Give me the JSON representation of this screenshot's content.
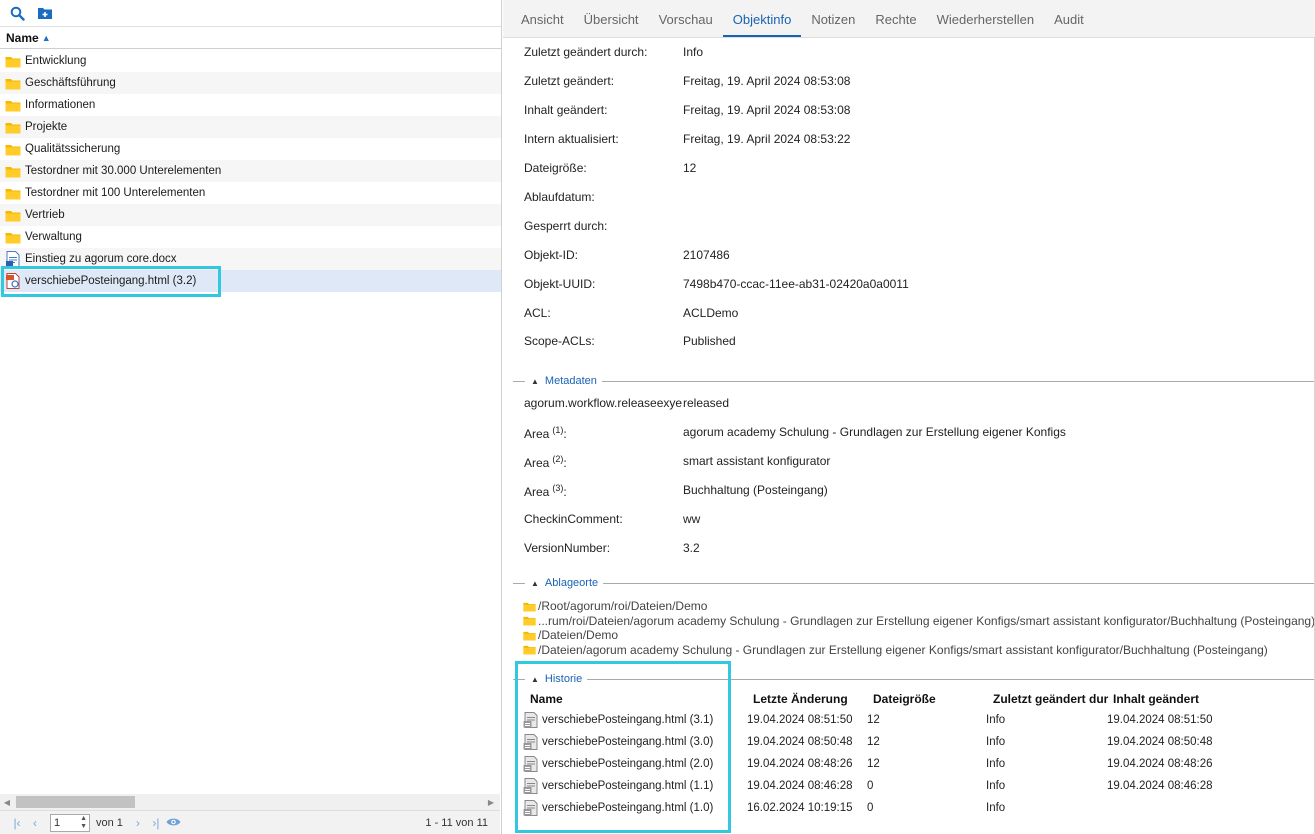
{
  "left": {
    "column_header": "Name",
    "items": [
      {
        "label": "Entwicklung",
        "type": "folder"
      },
      {
        "label": "Geschäftsführung",
        "type": "folder"
      },
      {
        "label": "Informationen",
        "type": "folder"
      },
      {
        "label": "Projekte",
        "type": "folder"
      },
      {
        "label": "Qualitätssicherung",
        "type": "folder"
      },
      {
        "label": "Testordner mit 30.000 Unterelementen",
        "type": "folder"
      },
      {
        "label": "Testordner mit 100 Unterelementen",
        "type": "folder"
      },
      {
        "label": "Vertrieb",
        "type": "folder"
      },
      {
        "label": "Verwaltung",
        "type": "folder"
      },
      {
        "label": "Einstieg zu agorum core.docx",
        "type": "docx"
      },
      {
        "label": "verschiebePosteingang.html (3.2)",
        "type": "html"
      }
    ],
    "pager": {
      "page": "1",
      "of_label": "von 1",
      "count": "1 - 11 von 11"
    }
  },
  "tabs": [
    "Ansicht",
    "Übersicht",
    "Vorschau",
    "Objektinfo",
    "Notizen",
    "Rechte",
    "Wiederherstellen",
    "Audit"
  ],
  "info": {
    "rows": [
      {
        "label": "Zuletzt geändert durch:",
        "value": "Info"
      },
      {
        "label": "Zuletzt geändert:",
        "value": "Freitag, 19. April 2024 08:53:08"
      },
      {
        "label": "Inhalt geändert:",
        "value": "Freitag, 19. April 2024 08:53:08"
      },
      {
        "label": "Intern aktualisiert:",
        "value": "Freitag, 19. April 2024 08:53:22"
      },
      {
        "label": "Dateigröße:",
        "value": "12"
      },
      {
        "label": "Ablaufdatum:",
        "value": ""
      },
      {
        "label": "Gesperrt durch:",
        "value": ""
      },
      {
        "label": "Objekt-ID:",
        "value": "2107486"
      },
      {
        "label": "Objekt-UUID:",
        "value": "7498b470-ccac-11ee-ab31-02420a0a0011"
      },
      {
        "label": "ACL:",
        "value": "ACLDemo"
      },
      {
        "label": "Scope-ACLs:",
        "value": "Published"
      }
    ]
  },
  "metadata": {
    "title": "Metadaten",
    "rows": [
      {
        "label": "agorum.workflow.releaseexye",
        "sup": "",
        "value": "released"
      },
      {
        "label": "Area",
        "sup": "(1)",
        "suffix": ":",
        "value": "agorum academy Schulung - Grundlagen zur Erstellung eigener Konfigs"
      },
      {
        "label": "Area",
        "sup": "(2)",
        "suffix": ":",
        "value": "smart assistant konfigurator"
      },
      {
        "label": "Area",
        "sup": "(3)",
        "suffix": ":",
        "value": "Buchhaltung (Posteingang)"
      },
      {
        "label": "CheckinComment:",
        "sup": "",
        "value": "ww"
      },
      {
        "label": "VersionNumber:",
        "sup": "",
        "value": "3.2"
      }
    ]
  },
  "locations": {
    "title": "Ablageorte",
    "items": [
      "/Root/agorum/roi/Dateien/Demo",
      "...rum/roi/Dateien/agorum academy Schulung - Grundlagen zur Erstellung eigener Konfigs/smart assistant konfigurator/Buchhaltung (Posteingang)",
      "/Dateien/Demo",
      "/Dateien/agorum academy Schulung - Grundlagen zur Erstellung eigener Konfigs/smart assistant konfigurator/Buchhaltung (Posteingang)"
    ]
  },
  "history": {
    "title": "Historie",
    "headers": [
      "Name",
      "Letzte Änderung",
      "Dateigröße",
      "Zuletzt geändert dur",
      "Inhalt geändert"
    ],
    "rows": [
      {
        "name": "verschiebePosteingang.html (3.1)",
        "changed": "19.04.2024 08:51:50",
        "size": "12",
        "by": "Info",
        "content": "19.04.2024 08:51:50"
      },
      {
        "name": "verschiebePosteingang.html (3.0)",
        "changed": "19.04.2024 08:50:48",
        "size": "12",
        "by": "Info",
        "content": "19.04.2024 08:50:48"
      },
      {
        "name": "verschiebePosteingang.html (2.0)",
        "changed": "19.04.2024 08:48:26",
        "size": "12",
        "by": "Info",
        "content": "19.04.2024 08:48:26"
      },
      {
        "name": "verschiebePosteingang.html (1.1)",
        "changed": "19.04.2024 08:46:28",
        "size": "0",
        "by": "Info",
        "content": "19.04.2024 08:46:28"
      },
      {
        "name": "verschiebePosteingang.html (1.0)",
        "changed": "16.02.2024 10:19:15",
        "size": "0",
        "by": "Info",
        "content": ""
      }
    ]
  },
  "colors": {
    "accent": "#1863b3",
    "highlight": "#32c8e0",
    "folder": "#f5b800"
  }
}
